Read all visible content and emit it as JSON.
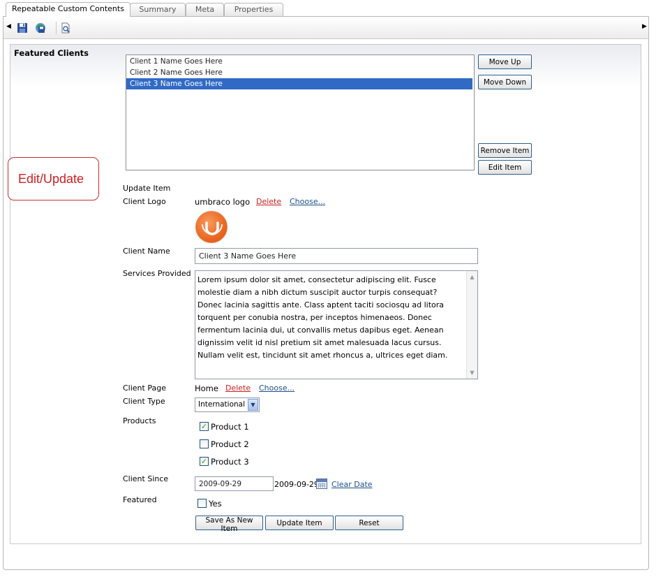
{
  "tabs": [
    {
      "label": "Repeatable Custom Contents",
      "active": true
    },
    {
      "label": "Summary",
      "active": false
    },
    {
      "label": "Meta",
      "active": false
    },
    {
      "label": "Properties",
      "active": false
    }
  ],
  "toolbar": {
    "icons": [
      "left-arrow-icon",
      "save-icon",
      "save-and-publish-icon",
      "preview-icon",
      "right-arrow-icon"
    ]
  },
  "section": {
    "title": "Featured Clients"
  },
  "list": {
    "items": [
      {
        "label": "Client 1 Name Goes Here",
        "selected": false
      },
      {
        "label": "Client 2 Name Goes Here",
        "selected": false
      },
      {
        "label": "Client 3 Name Goes Here",
        "selected": true
      }
    ],
    "buttons": {
      "move_up": "Move Up",
      "move_down": "Move Down",
      "remove_item": "Remove Item",
      "edit_item": "Edit Item"
    }
  },
  "callout": {
    "text": "Edit/Update"
  },
  "form": {
    "heading": "Update Item",
    "client_logo": {
      "label": "Client Logo",
      "value": "umbraco logo",
      "delete": "Delete",
      "choose": "Choose..."
    },
    "client_name": {
      "label": "Client Name",
      "value": "Client 3 Name Goes Here"
    },
    "services": {
      "label": "Services Provided",
      "value": "Lorem ipsum dolor sit amet, consectetur adipiscing elit. Fusce molestie diam a nibh dictum suscipit auctor turpis consequat? Donec lacinia sagittis ante. Class aptent taciti sociosqu ad litora torquent per conubia nostra, per inceptos himenaeos. Donec fermentum lacinia dui, ut convallis metus dapibus eget. Aenean dignissim velit id nisl pretium sit amet malesuada lacus cursus. Nullam velit est, tincidunt sit amet rhoncus a, ultrices eget diam."
    },
    "client_page": {
      "label": "Client Page",
      "value": "Home",
      "delete": "Delete",
      "choose": "Choose..."
    },
    "client_type": {
      "label": "Client Type",
      "value": "International"
    },
    "products": {
      "label": "Products",
      "options": [
        {
          "label": "Product 1",
          "checked": true
        },
        {
          "label": "Product 2",
          "checked": false
        },
        {
          "label": "Product 3",
          "checked": true
        }
      ]
    },
    "client_since": {
      "label": "Client Since",
      "input_value": "2009-09-29",
      "display_value": "2009-09-29",
      "clear": "Clear Date"
    },
    "featured": {
      "label": "Featured",
      "option": "Yes",
      "checked": false
    },
    "buttons": {
      "save_new": "Save As New Item",
      "update": "Update Item",
      "reset": "Reset"
    }
  }
}
